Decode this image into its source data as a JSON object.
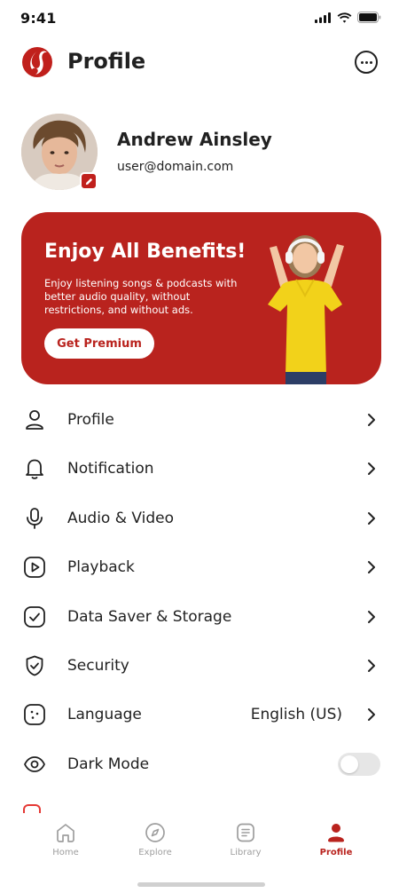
{
  "status_bar": {
    "time": "9:41"
  },
  "header": {
    "title": "Profile"
  },
  "user": {
    "name": "Andrew Ainsley",
    "email": "user@domain.com"
  },
  "promo": {
    "title": "Enjoy All Benefits!",
    "description": "Enjoy listening songs & podcasts with better audio quality, without restrictions, and without ads.",
    "button_label": "Get Premium"
  },
  "settings": {
    "items": [
      {
        "label": "Profile",
        "icon": "user-icon"
      },
      {
        "label": "Notification",
        "icon": "bell-icon"
      },
      {
        "label": "Audio & Video",
        "icon": "microphone-icon"
      },
      {
        "label": "Playback",
        "icon": "play-icon"
      },
      {
        "label": "Data Saver & Storage",
        "icon": "checkbox-icon"
      },
      {
        "label": "Security",
        "icon": "shield-icon"
      },
      {
        "label": "Language",
        "icon": "globe-icon",
        "value": "English (US)"
      },
      {
        "label": "Dark Mode",
        "icon": "eye-icon",
        "toggle": false
      }
    ]
  },
  "bottom_nav": {
    "items": [
      {
        "label": "Home",
        "icon": "home-icon"
      },
      {
        "label": "Explore",
        "icon": "compass-icon"
      },
      {
        "label": "Library",
        "icon": "library-icon"
      },
      {
        "label": "Profile",
        "icon": "profile-icon",
        "active": true
      }
    ]
  },
  "colors": {
    "accent": "#b9231e",
    "text": "#212121",
    "muted": "#9e9e9e"
  }
}
